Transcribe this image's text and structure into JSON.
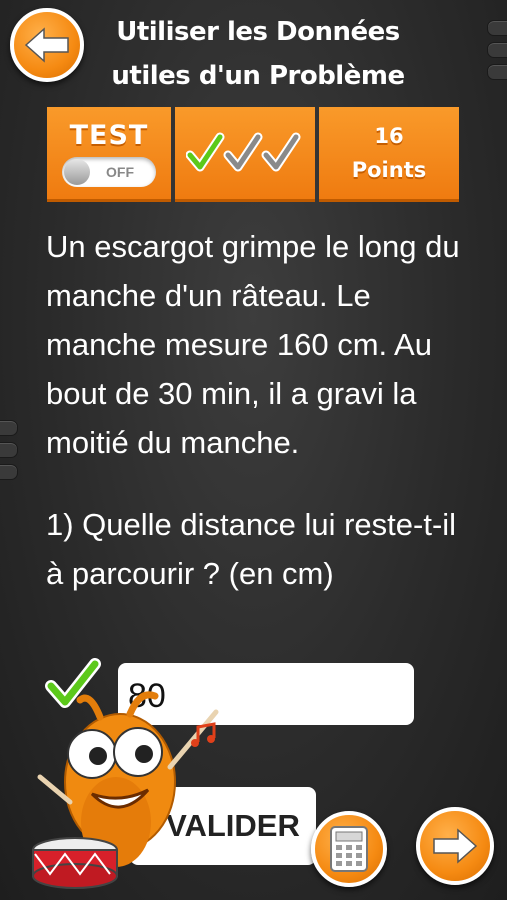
{
  "header": {
    "title_line1": "Utiliser les Données",
    "title_line2": "utiles d'un Problème"
  },
  "status_bar": {
    "test_label": "TEST",
    "toggle_state": "OFF",
    "checks_earned": 3,
    "points_value": "16",
    "points_label": "Points"
  },
  "problem": {
    "statement": "Un escargot grimpe le long du manche d'un râteau. Le manche mesure 160 cm. Au bout de 30 min, il a gravi la moitié du manche.",
    "question": "1) Quelle distance lui reste-t-il à parcourir ? (en cm)"
  },
  "answer": {
    "value": "80",
    "status": "correct"
  },
  "actions": {
    "validate_label": "VALIDER"
  },
  "colors": {
    "accent": "#f58a12",
    "correct": "#5cc91a",
    "background": "#2b2b2b"
  },
  "icons": [
    "back-arrow-icon",
    "next-arrow-icon",
    "calculator-icon",
    "checkmark-icon",
    "mascot-drummer"
  ]
}
